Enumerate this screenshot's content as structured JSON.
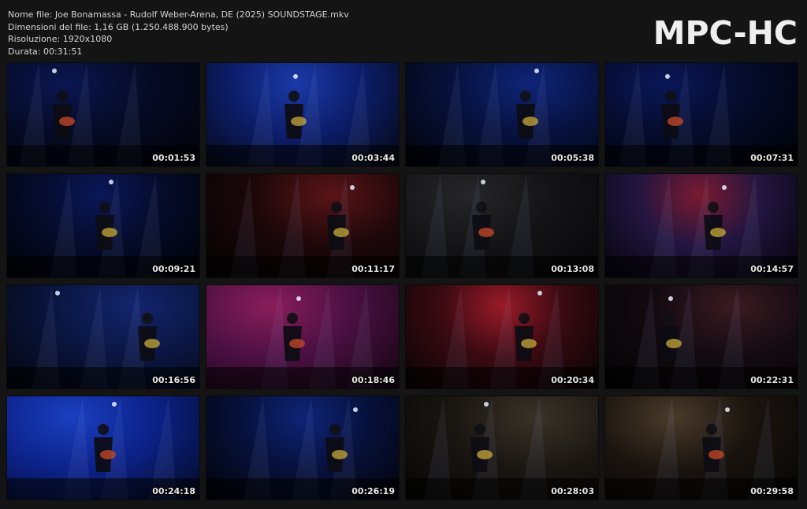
{
  "file_info": {
    "name_line": "Nome file: Joe Bonamassa - Rudolf Weber-Arena, DE (2025) SOUNDSTAGE.mkv",
    "size_line": "Dimensioni del file: 1,16 GB (1.250.488.900 bytes)",
    "resolution_line": "Risoluzione: 1920x1080",
    "duration_line": "Durata: 00:31:51"
  },
  "logo": "MPC-HC",
  "thumbnails": [
    {
      "time": "00:01:53",
      "scene": "blue"
    },
    {
      "time": "00:03:44",
      "scene": "stage-wide-blue"
    },
    {
      "time": "00:05:38",
      "scene": "stage-wide-dark-blue"
    },
    {
      "time": "00:07:31",
      "scene": "dark-blue-guitarist"
    },
    {
      "time": "00:09:21",
      "scene": "dark-blue-guitarist"
    },
    {
      "time": "00:11:17",
      "scene": "stage-wide-red"
    },
    {
      "time": "00:13:08",
      "scene": "closeup-dark-red-guitar"
    },
    {
      "time": "00:14:57",
      "scene": "stage-wide-red-blue"
    },
    {
      "time": "00:16:56",
      "scene": "blue-guitarist-mic"
    },
    {
      "time": "00:18:46",
      "scene": "closeup-red-curtain"
    },
    {
      "time": "00:20:34",
      "scene": "stage-red-curtain"
    },
    {
      "time": "00:22:31",
      "scene": "stage-wide-dark"
    },
    {
      "time": "00:24:18",
      "scene": "blue-curtain-duo"
    },
    {
      "time": "00:26:19",
      "scene": "stage-wide-dark-blue"
    },
    {
      "time": "00:28:03",
      "scene": "stage-amber-piano"
    },
    {
      "time": "00:29:58",
      "scene": "stage-wide-amber"
    }
  ]
}
